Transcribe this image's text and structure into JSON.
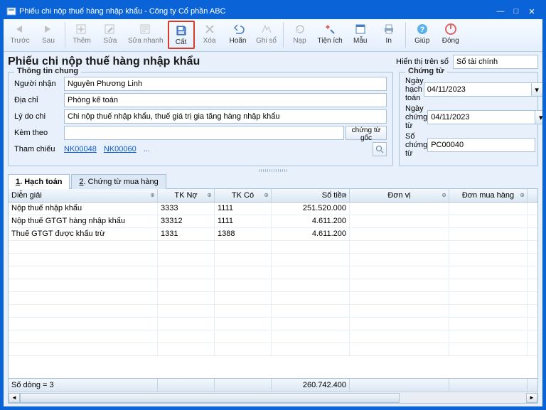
{
  "window": {
    "title": "Phiếu chi nộp thuế hàng nhập khẩu - Công ty Cổ phần ABC"
  },
  "toolbar": {
    "prev": "Trước",
    "next": "Sau",
    "add": "Thêm",
    "edit": "Sửa",
    "quickedit": "Sửa nhanh",
    "save": "Cất",
    "delete": "Xóa",
    "undo": "Hoãn",
    "post": "Ghi sổ",
    "load": "Nạp",
    "util": "Tiện ích",
    "template": "Mẫu",
    "print": "In",
    "help": "Giúp",
    "close": "Đóng"
  },
  "header": {
    "page_title": "Phiếu chi nộp thuế hàng nhập khẩu",
    "display_label": "Hiển thị trên sổ",
    "display_value": "Sổ tài chính"
  },
  "general": {
    "legend": "Thông tin chung",
    "recipient_label": "Người nhận",
    "recipient": "Nguyễn Phương Linh",
    "address_label": "Địa chỉ",
    "address": "Phòng kế toán",
    "reason_label": "Lý do chi",
    "reason": "Chi nộp thuế nhập khẩu, thuế giá trị gia tăng hàng nhập khẩu",
    "attach_label": "Kèm theo",
    "attach": "",
    "attach_btn": "chứng từ gốc",
    "ref_label": "Tham chiếu",
    "ref1": "NK00048",
    "ref2": "NK00060",
    "ref_more": "..."
  },
  "voucher": {
    "legend": "Chứng từ",
    "postdate_label": "Ngày hạch toán",
    "postdate": "04/11/2023",
    "vdate_label": "Ngày chứng từ",
    "vdate": "04/11/2023",
    "vno_label": "Số chứng từ",
    "vno": "PC00040"
  },
  "tabs": {
    "t1_num": "1",
    "t1": ". Hạch toán",
    "t2_num": "2",
    "t2": ". Chứng từ mua hàng"
  },
  "grid": {
    "headers": {
      "desc": "Diễn giải",
      "debit": "TK Nợ",
      "credit": "TK Có",
      "amount": "Số tiền",
      "unit": "Đơn vị",
      "purchase": "Đơn mua hàng"
    },
    "rows": [
      {
        "desc": "Nộp thuế nhập khẩu",
        "debit": "3333",
        "credit": "1111",
        "amount": "251.520.000",
        "unit": "",
        "purchase": ""
      },
      {
        "desc": "Nộp thuế GTGT hàng nhập khẩu",
        "debit": "33312",
        "credit": "1111",
        "amount": "4.611.200",
        "unit": "",
        "purchase": ""
      },
      {
        "desc": "Thuế GTGT được khấu trừ",
        "debit": "1331",
        "credit": "1388",
        "amount": "4.611.200",
        "unit": "",
        "purchase": ""
      }
    ],
    "footer": {
      "rowcount": "Số dòng = 3",
      "total": "260.742.400"
    }
  }
}
